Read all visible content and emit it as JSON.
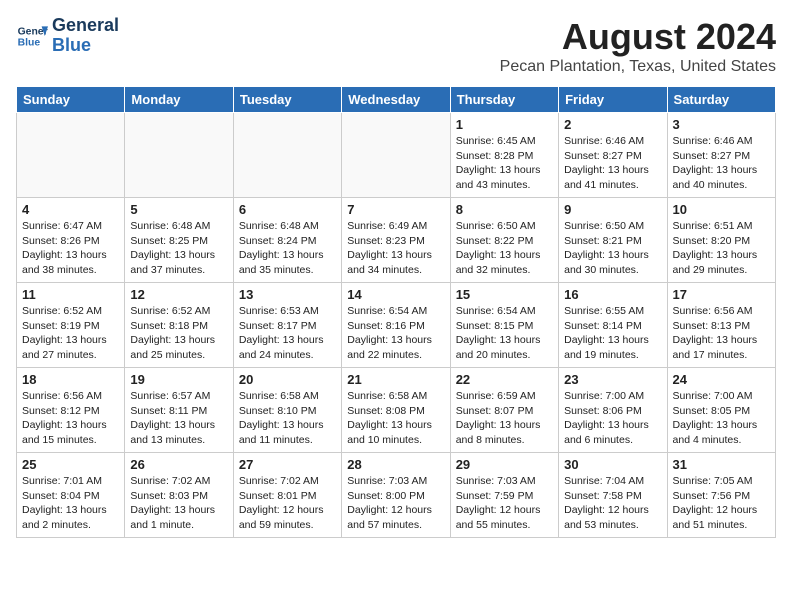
{
  "header": {
    "logo_line1": "General",
    "logo_line2": "Blue",
    "month": "August 2024",
    "location": "Pecan Plantation, Texas, United States"
  },
  "weekdays": [
    "Sunday",
    "Monday",
    "Tuesday",
    "Wednesday",
    "Thursday",
    "Friday",
    "Saturday"
  ],
  "weeks": [
    [
      {
        "day": "",
        "info": ""
      },
      {
        "day": "",
        "info": ""
      },
      {
        "day": "",
        "info": ""
      },
      {
        "day": "",
        "info": ""
      },
      {
        "day": "1",
        "info": "Sunrise: 6:45 AM\nSunset: 8:28 PM\nDaylight: 13 hours\nand 43 minutes."
      },
      {
        "day": "2",
        "info": "Sunrise: 6:46 AM\nSunset: 8:27 PM\nDaylight: 13 hours\nand 41 minutes."
      },
      {
        "day": "3",
        "info": "Sunrise: 6:46 AM\nSunset: 8:27 PM\nDaylight: 13 hours\nand 40 minutes."
      }
    ],
    [
      {
        "day": "4",
        "info": "Sunrise: 6:47 AM\nSunset: 8:26 PM\nDaylight: 13 hours\nand 38 minutes."
      },
      {
        "day": "5",
        "info": "Sunrise: 6:48 AM\nSunset: 8:25 PM\nDaylight: 13 hours\nand 37 minutes."
      },
      {
        "day": "6",
        "info": "Sunrise: 6:48 AM\nSunset: 8:24 PM\nDaylight: 13 hours\nand 35 minutes."
      },
      {
        "day": "7",
        "info": "Sunrise: 6:49 AM\nSunset: 8:23 PM\nDaylight: 13 hours\nand 34 minutes."
      },
      {
        "day": "8",
        "info": "Sunrise: 6:50 AM\nSunset: 8:22 PM\nDaylight: 13 hours\nand 32 minutes."
      },
      {
        "day": "9",
        "info": "Sunrise: 6:50 AM\nSunset: 8:21 PM\nDaylight: 13 hours\nand 30 minutes."
      },
      {
        "day": "10",
        "info": "Sunrise: 6:51 AM\nSunset: 8:20 PM\nDaylight: 13 hours\nand 29 minutes."
      }
    ],
    [
      {
        "day": "11",
        "info": "Sunrise: 6:52 AM\nSunset: 8:19 PM\nDaylight: 13 hours\nand 27 minutes."
      },
      {
        "day": "12",
        "info": "Sunrise: 6:52 AM\nSunset: 8:18 PM\nDaylight: 13 hours\nand 25 minutes."
      },
      {
        "day": "13",
        "info": "Sunrise: 6:53 AM\nSunset: 8:17 PM\nDaylight: 13 hours\nand 24 minutes."
      },
      {
        "day": "14",
        "info": "Sunrise: 6:54 AM\nSunset: 8:16 PM\nDaylight: 13 hours\nand 22 minutes."
      },
      {
        "day": "15",
        "info": "Sunrise: 6:54 AM\nSunset: 8:15 PM\nDaylight: 13 hours\nand 20 minutes."
      },
      {
        "day": "16",
        "info": "Sunrise: 6:55 AM\nSunset: 8:14 PM\nDaylight: 13 hours\nand 19 minutes."
      },
      {
        "day": "17",
        "info": "Sunrise: 6:56 AM\nSunset: 8:13 PM\nDaylight: 13 hours\nand 17 minutes."
      }
    ],
    [
      {
        "day": "18",
        "info": "Sunrise: 6:56 AM\nSunset: 8:12 PM\nDaylight: 13 hours\nand 15 minutes."
      },
      {
        "day": "19",
        "info": "Sunrise: 6:57 AM\nSunset: 8:11 PM\nDaylight: 13 hours\nand 13 minutes."
      },
      {
        "day": "20",
        "info": "Sunrise: 6:58 AM\nSunset: 8:10 PM\nDaylight: 13 hours\nand 11 minutes."
      },
      {
        "day": "21",
        "info": "Sunrise: 6:58 AM\nSunset: 8:08 PM\nDaylight: 13 hours\nand 10 minutes."
      },
      {
        "day": "22",
        "info": "Sunrise: 6:59 AM\nSunset: 8:07 PM\nDaylight: 13 hours\nand 8 minutes."
      },
      {
        "day": "23",
        "info": "Sunrise: 7:00 AM\nSunset: 8:06 PM\nDaylight: 13 hours\nand 6 minutes."
      },
      {
        "day": "24",
        "info": "Sunrise: 7:00 AM\nSunset: 8:05 PM\nDaylight: 13 hours\nand 4 minutes."
      }
    ],
    [
      {
        "day": "25",
        "info": "Sunrise: 7:01 AM\nSunset: 8:04 PM\nDaylight: 13 hours\nand 2 minutes."
      },
      {
        "day": "26",
        "info": "Sunrise: 7:02 AM\nSunset: 8:03 PM\nDaylight: 13 hours\nand 1 minute."
      },
      {
        "day": "27",
        "info": "Sunrise: 7:02 AM\nSunset: 8:01 PM\nDaylight: 12 hours\nand 59 minutes."
      },
      {
        "day": "28",
        "info": "Sunrise: 7:03 AM\nSunset: 8:00 PM\nDaylight: 12 hours\nand 57 minutes."
      },
      {
        "day": "29",
        "info": "Sunrise: 7:03 AM\nSunset: 7:59 PM\nDaylight: 12 hours\nand 55 minutes."
      },
      {
        "day": "30",
        "info": "Sunrise: 7:04 AM\nSunset: 7:58 PM\nDaylight: 12 hours\nand 53 minutes."
      },
      {
        "day": "31",
        "info": "Sunrise: 7:05 AM\nSunset: 7:56 PM\nDaylight: 12 hours\nand 51 minutes."
      }
    ]
  ]
}
